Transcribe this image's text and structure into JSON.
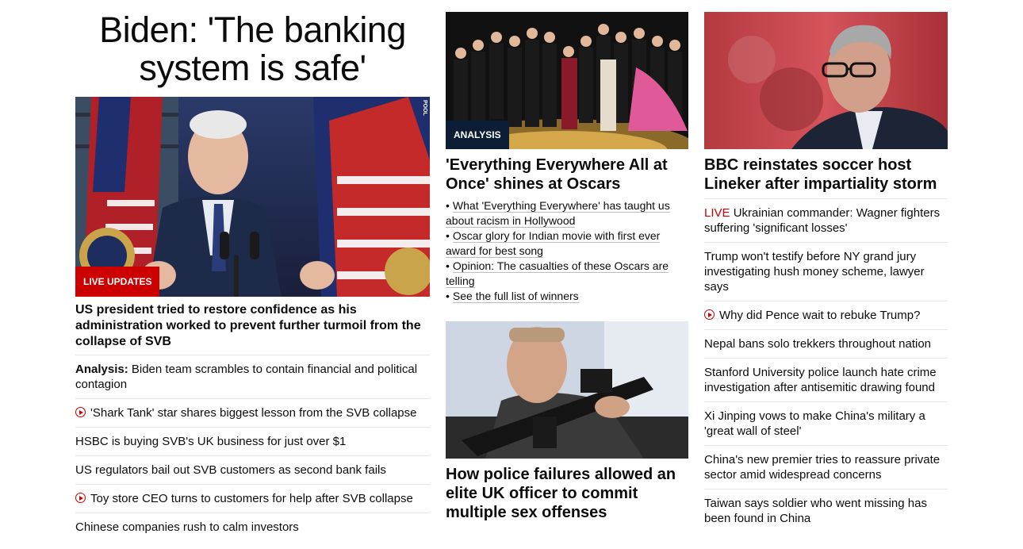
{
  "main": {
    "headline": "Biden: 'The banking system is safe'",
    "badge": "LIVE UPDATES",
    "pool_credit": "POOL",
    "lead": "US president tried to restore confidence as his administration worked to prevent further turmoil from the collapse of SVB",
    "items": [
      {
        "prefix": "Analysis:",
        "text": " Biden team scrambles to contain financial and political contagion",
        "video": false
      },
      {
        "prefix": "",
        "text": "'Shark Tank' star shares biggest lesson from the SVB collapse",
        "video": true
      },
      {
        "prefix": "",
        "text": "HSBC is buying SVB's UK business for just over $1",
        "video": false
      },
      {
        "prefix": "",
        "text": "US regulators bail out SVB customers as second bank fails",
        "video": false
      },
      {
        "prefix": "",
        "text": "Toy store CEO turns to customers for help after SVB collapse",
        "video": true
      },
      {
        "prefix": "",
        "text": "Chinese companies rush to calm investors",
        "video": false
      }
    ]
  },
  "oscars": {
    "badge": "ANALYSIS",
    "title": "'Everything Everywhere All at Once' shines at Oscars",
    "bullets": [
      "What 'Everything Everywhere' has taught us about racism in Hollywood",
      "Oscar glory for Indian movie with first ever award for best song",
      "Opinion: The casualties of these Oscars are telling",
      "See the full list of winners"
    ]
  },
  "police": {
    "title": "How police failures allowed an elite UK officer to commit multiple sex offenses"
  },
  "lineker": {
    "title": "BBC reinstates soccer host Lineker after impartiality storm",
    "items": [
      {
        "live": "LIVE",
        "text": " Ukrainian commander: Wagner fighters suffering 'significant losses'",
        "video": false
      },
      {
        "live": "",
        "text": "Trump won't testify before NY grand jury investigating hush money scheme, lawyer says",
        "video": false
      },
      {
        "live": "",
        "text": "Why did Pence wait to rebuke Trump?",
        "video": true
      },
      {
        "live": "",
        "text": "Nepal bans solo trekkers throughout nation",
        "video": false
      },
      {
        "live": "",
        "text": "Stanford University police launch hate crime investigation after antisemitic drawing found",
        "video": false
      },
      {
        "live": "",
        "text": "Xi Jinping vows to make China's military a 'great wall of steel'",
        "video": false
      },
      {
        "live": "",
        "text": "China's new premier tries to reassure private sector amid widespread concerns",
        "video": false
      },
      {
        "live": "",
        "text": "Taiwan says soldier who went missing has been found in China",
        "video": false
      }
    ]
  },
  "colors": {
    "live_red": "#cc0000",
    "analysis_navy": "#0c1e35"
  },
  "icons": {
    "video": "play-circle-icon"
  }
}
